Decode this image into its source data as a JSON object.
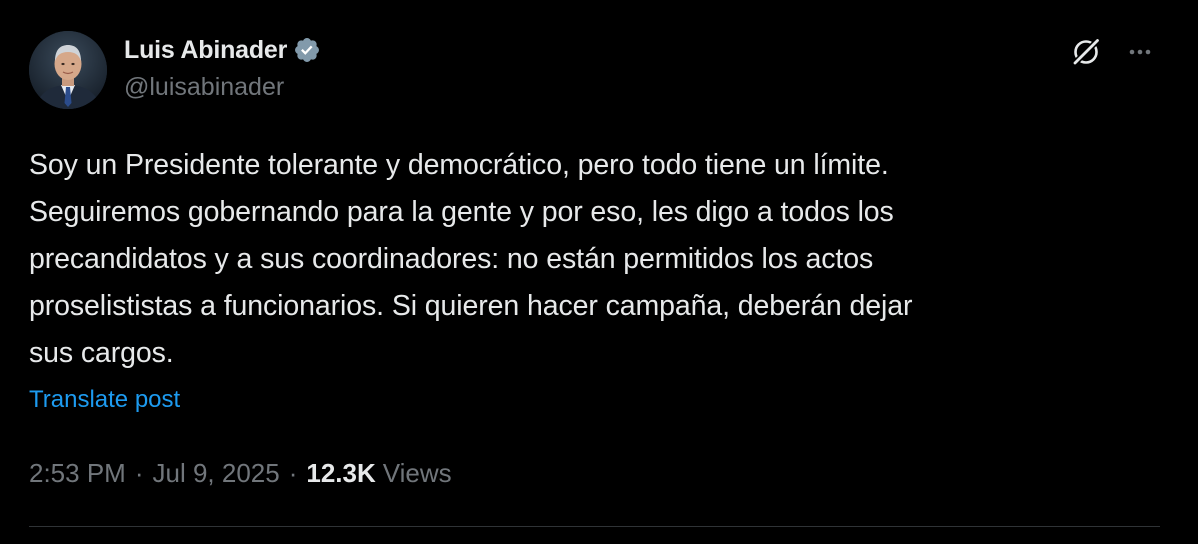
{
  "author": {
    "display_name": "Luis Abinader",
    "handle": "@luisabinader",
    "verified": true,
    "avatar_icon": "profile-photo",
    "verified_icon": "verified-badge-icon",
    "verified_color": "#829aab"
  },
  "actions": {
    "grok_icon": "grok-icon",
    "more_icon": "more-icon"
  },
  "tweet": {
    "lines": [
      "Soy un Presidente tolerante y democrático, pero todo tiene un límite.",
      "Seguiremos gobernando para la gente y por eso, les digo a todos los",
      "precandidatos y a sus coordinadores: no están permitidos los actos",
      "proselististas a funcionarios. Si quieren hacer campaña, deberán dejar",
      "sus cargos."
    ],
    "translate_label": "Translate post"
  },
  "meta": {
    "time": "2:53 PM",
    "separator": "·",
    "date": "Jul 9, 2025",
    "views_count": "12.3K",
    "views_label": "Views"
  },
  "colors": {
    "background": "#000000",
    "primary_text": "#e7e9ea",
    "secondary_text": "#71767b",
    "link": "#1d9bf0",
    "divider": "#2f3336"
  }
}
